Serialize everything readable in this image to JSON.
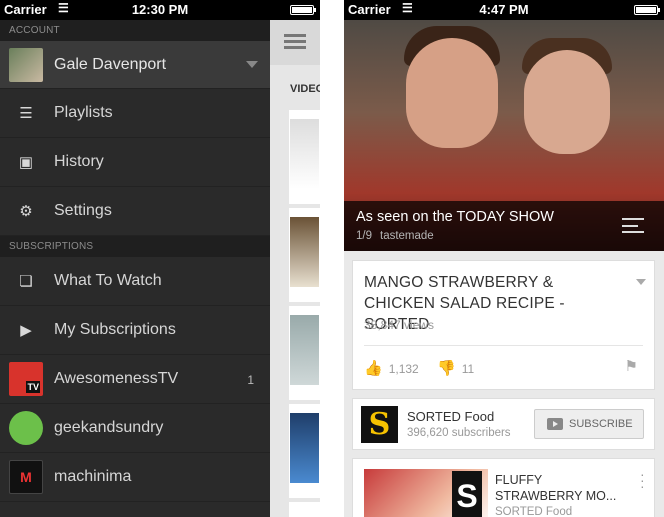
{
  "left": {
    "status": {
      "carrier": "Carrier",
      "time": "12:30 PM"
    },
    "account": {
      "section_label": "ACCOUNT",
      "name": "Gale Davenport"
    },
    "menu": [
      {
        "label": "Playlists",
        "icon": "playlist-icon"
      },
      {
        "label": "History",
        "icon": "history-icon"
      },
      {
        "label": "Settings",
        "icon": "gear-icon"
      }
    ],
    "subscriptions": {
      "section_label": "SUBSCRIPTIONS",
      "items": [
        {
          "label": "What To Watch",
          "icon": "stack-icon"
        },
        {
          "label": "My Subscriptions",
          "icon": "subscriptions-icon"
        },
        {
          "label": "AwesomenessTV",
          "count": "1"
        },
        {
          "label": "geekandsundry"
        },
        {
          "label": "machinima"
        }
      ]
    },
    "peek": {
      "tab_label": "VIDEO"
    }
  },
  "right": {
    "status": {
      "carrier": "Carrier",
      "time": "4:47 PM"
    },
    "player": {
      "title": "As seen on the TODAY SHOW",
      "position": "1/9",
      "channel": "tastemade"
    },
    "video": {
      "title": "MANGO STRAWBERRY & CHICKEN SALAD RECIPE - SORTED",
      "views": "38,847 views",
      "likes": "1,132",
      "dislikes": "11"
    },
    "channel": {
      "logo_letter": "S",
      "name": "SORTED Food",
      "subscribers": "396,620 subscribers",
      "subscribe_label": "SUBSCRIBE"
    },
    "related": {
      "title": "FLUFFY STRAWBERRY MO...",
      "channel": "SORTED Food"
    }
  }
}
